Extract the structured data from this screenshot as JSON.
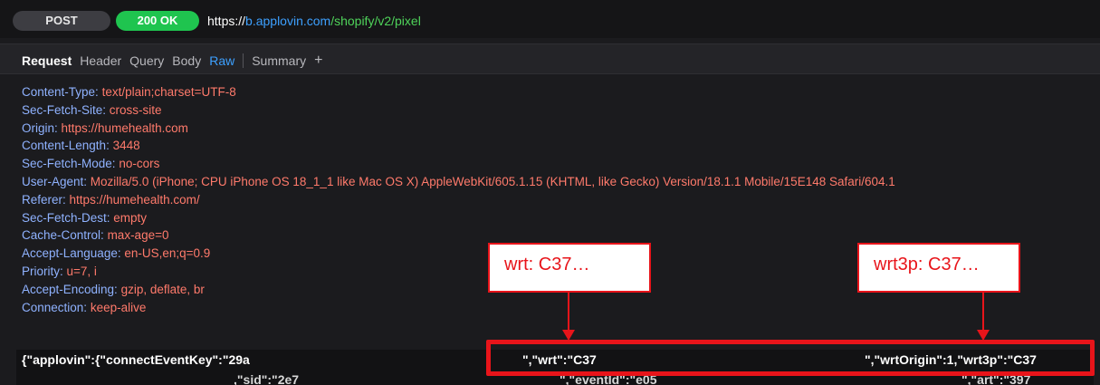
{
  "request": {
    "method": "POST",
    "status": "200 OK",
    "url_prefix": "https://",
    "url_host": "b.applovin.com",
    "url_path": "/shopify/v2/pixel"
  },
  "tabs": [
    {
      "label": "Request"
    },
    {
      "label": "Header"
    },
    {
      "label": "Query"
    },
    {
      "label": "Body"
    },
    {
      "label": "Raw"
    },
    {
      "label": "Summary"
    },
    {
      "label": "+"
    }
  ],
  "headers": [
    {
      "key": "Content-Type:",
      "value": "text/plain;charset=UTF-8"
    },
    {
      "key": "Sec-Fetch-Site:",
      "value": "cross-site"
    },
    {
      "key": "Origin:",
      "value": "https://humehealth.com"
    },
    {
      "key": "Content-Length:",
      "value": "3448"
    },
    {
      "key": "Sec-Fetch-Mode:",
      "value": "no-cors"
    },
    {
      "key": "User-Agent:",
      "value": "Mozilla/5.0 (iPhone; CPU iPhone OS 18_1_1 like Mac OS X) AppleWebKit/605.1.15 (KHTML, like Gecko) Version/18.1.1 Mobile/15E148 Safari/604.1"
    },
    {
      "key": "Referer:",
      "value": "https://humehealth.com/"
    },
    {
      "key": "Sec-Fetch-Dest:",
      "value": "empty"
    },
    {
      "key": "Cache-Control:",
      "value": "max-age=0"
    },
    {
      "key": "Accept-Language:",
      "value": "en-US,en;q=0.9"
    },
    {
      "key": "Priority:",
      "value": "u=7, i"
    },
    {
      "key": "Accept-Encoding:",
      "value": "gzip, deflate, br"
    },
    {
      "key": "Connection:",
      "value": "keep-alive"
    }
  ],
  "body_line1": {
    "part1": "{\"applovin\":{\"connectEventKey\":\"29a",
    "part2": "\",\"wrt\":\"C37",
    "part3": "\",\"wrtOrigin\":1,\"wrt3p\":\"C37"
  },
  "body_line2": {
    "part1": ",\"sid\":\"2e7",
    "part2": "\",\"eventId\":\"e05",
    "part3": "\",\"art\":\"397"
  },
  "annotations": {
    "callout_wrt": "wrt: C37…",
    "callout_wrt3p": "wrt3p: C37…",
    "color": "#e8141a"
  },
  "colors": {
    "status_green": "#1fc44f",
    "active_tab": "#3da0ff",
    "header_key": "#8fb2ff",
    "header_value": "#ff7a6b"
  }
}
